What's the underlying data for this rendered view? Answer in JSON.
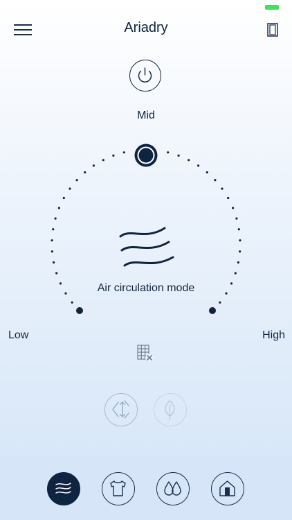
{
  "app": {
    "title": "Ariadry"
  },
  "dial": {
    "top_label": "Mid",
    "left_label": "Low",
    "right_label": "High",
    "mode_label": "Air circulation mode",
    "level": "Mid"
  },
  "icons": {
    "menu": "hamburger-icon",
    "device": "door-icon",
    "power": "power-icon",
    "mode": "air-waves-icon",
    "filter": "filter-grid-icon",
    "swing": "swing-arrows-icon",
    "eco": "leaf-icon"
  },
  "tabs": [
    {
      "name": "air-circulation",
      "icon": "air-waves-icon",
      "active": true
    },
    {
      "name": "clothes",
      "icon": "tshirt-icon",
      "active": false
    },
    {
      "name": "dehumidify",
      "icon": "water-drops-icon",
      "active": false
    },
    {
      "name": "home",
      "icon": "home-icon",
      "active": false
    }
  ],
  "colors": {
    "accent": "#0f2440",
    "battery": "#4cd964",
    "disabled": "#b4c4d8"
  }
}
